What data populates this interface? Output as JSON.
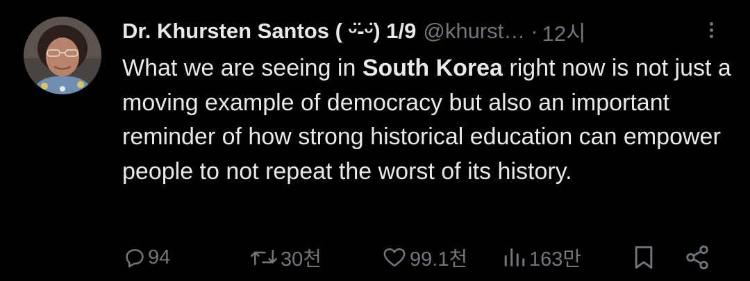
{
  "author": {
    "name": "Dr. Khursten Santos ( ᵕ̈-ᵕ̈) 1/9",
    "handle": "@khurst…",
    "separator": "·",
    "time": "12시"
  },
  "tweet": {
    "text_before": "What we are seeing in ",
    "text_bold": "South Korea",
    "text_after": " right now is not just a moving example of democracy but also an important reminder of how strong historical education can empower people to not repeat the worst of its history."
  },
  "actions": {
    "replies": "94",
    "retweets": "30천",
    "likes": "99.1천",
    "views": "163만"
  },
  "icons": {
    "avatar": "profile-photo",
    "more": "more-options-icon",
    "reply": "reply-icon",
    "retweet": "retweet-icon",
    "like": "heart-icon",
    "views": "views-chart-icon",
    "bookmark": "bookmark-icon",
    "share": "share-icon"
  },
  "colors": {
    "background": "#000000",
    "text_primary": "#e7e9ea",
    "text_secondary": "#71767b"
  }
}
